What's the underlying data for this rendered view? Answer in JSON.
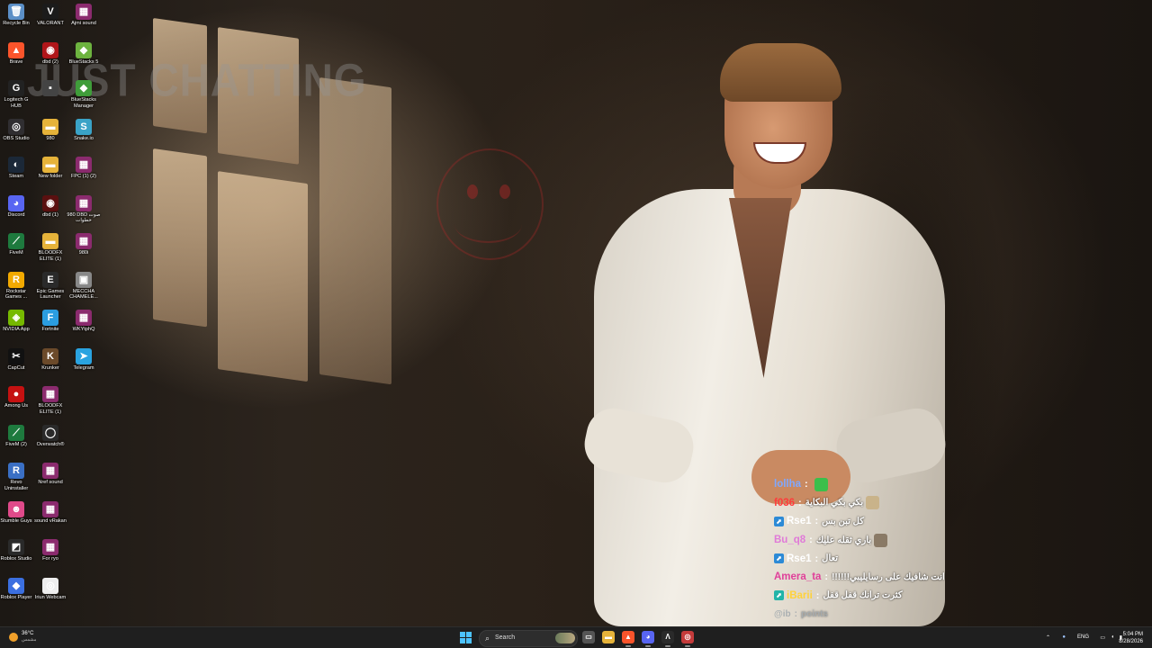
{
  "wallpaper": {
    "overlay_text": "JUST CHATTING"
  },
  "desktop_icons": [
    {
      "label": "Recycle Bin",
      "icon": "recycle-bin-icon",
      "color": "#5b8fc7",
      "glyph": "🗑"
    },
    {
      "label": "VALORANT",
      "icon": "valorant-icon",
      "color": "#1b1b1b",
      "glyph": "V"
    },
    {
      "label": "Ajmi sound",
      "icon": "winrar-icon",
      "color": "#8b2b6e",
      "glyph": "▦"
    },
    {
      "label": "Brave",
      "icon": "brave-icon",
      "color": "#fb542b",
      "glyph": "▲"
    },
    {
      "label": "dbd (2)",
      "icon": "dbd-icon",
      "color": "#b0161a",
      "glyph": "◉"
    },
    {
      "label": "BlueStacks 5",
      "icon": "bluestacks-icon",
      "color": "#6db33f",
      "glyph": "◆"
    },
    {
      "label": "Logitech G HUB",
      "icon": "logitech-icon",
      "color": "#222",
      "glyph": "G"
    },
    {
      "label": "",
      "icon": "app-icon",
      "color": "#444",
      "glyph": "▪"
    },
    {
      "label": "BlueStacks Manager",
      "icon": "bluestacks-manager-icon",
      "color": "#3f9d3a",
      "glyph": "◆"
    },
    {
      "label": "OBS Studio",
      "icon": "obs-icon",
      "color": "#302e31",
      "glyph": "◎"
    },
    {
      "label": "980",
      "icon": "folder-icon",
      "color": "#e6b33a",
      "glyph": "▬"
    },
    {
      "label": "Snake.io",
      "icon": "snake-icon",
      "color": "#3aa3c7",
      "glyph": "S"
    },
    {
      "label": "Steam",
      "icon": "steam-icon",
      "color": "#1b2838",
      "glyph": "◐"
    },
    {
      "label": "New folder",
      "icon": "folder-icon",
      "color": "#e6b33a",
      "glyph": "▬"
    },
    {
      "label": "FPC (1) (2)",
      "icon": "winrar-icon",
      "color": "#8b2b6e",
      "glyph": "▦"
    },
    {
      "label": "Discord",
      "icon": "discord-icon",
      "color": "#5865f2",
      "glyph": "◕"
    },
    {
      "label": "dbd (1)",
      "icon": "dbd-icon",
      "color": "#5a1010",
      "glyph": "◉"
    },
    {
      "label": "980 DBD صوت خطوات",
      "icon": "winrar-icon",
      "color": "#8b2b6e",
      "glyph": "▦"
    },
    {
      "label": "FiveM",
      "icon": "fivem-icon",
      "color": "#1e7a3e",
      "glyph": "⟋"
    },
    {
      "label": "BLOODFX ELITE (1)",
      "icon": "folder-icon",
      "color": "#e6b33a",
      "glyph": "▬"
    },
    {
      "label": "980i",
      "icon": "winrar-icon",
      "color": "#8b2b6e",
      "glyph": "▦"
    },
    {
      "label": "Rockstar Games ...",
      "icon": "rockstar-icon",
      "color": "#f2a900",
      "glyph": "R"
    },
    {
      "label": "Epic Games Launcher",
      "icon": "epic-icon",
      "color": "#2a2a2a",
      "glyph": "E"
    },
    {
      "label": "MECCHA CHAMELE...",
      "icon": "file-icon",
      "color": "#888",
      "glyph": "▣"
    },
    {
      "label": "NVIDIA App",
      "icon": "nvidia-icon",
      "color": "#76b900",
      "glyph": "◈"
    },
    {
      "label": "Fortnite",
      "icon": "fortnite-icon",
      "color": "#2b9de0",
      "glyph": "F"
    },
    {
      "label": "WKYtphQ",
      "icon": "winrar-icon",
      "color": "#8b2b6e",
      "glyph": "▦"
    },
    {
      "label": "CapCut",
      "icon": "capcut-icon",
      "color": "#111",
      "glyph": "✂"
    },
    {
      "label": "Krunker",
      "icon": "krunker-icon",
      "color": "#6b4a2a",
      "glyph": "K"
    },
    {
      "label": "Telegram",
      "icon": "telegram-icon",
      "color": "#2aa3e0",
      "glyph": "➤"
    },
    {
      "label": "Among Us",
      "icon": "among-us-icon",
      "color": "#c51111",
      "glyph": "●"
    },
    {
      "label": "BLOODFX ELITE (1)",
      "icon": "winrar-icon",
      "color": "#8b2b6e",
      "glyph": "▦"
    },
    {
      "label": "",
      "icon": "blank-icon",
      "color": "transparent",
      "glyph": ""
    },
    {
      "label": "FiveM (2)",
      "icon": "fivem-icon",
      "color": "#1e7a3e",
      "glyph": "⟋"
    },
    {
      "label": "Overwatch®",
      "icon": "overwatch-icon",
      "color": "#2a2a2a",
      "glyph": "◯"
    },
    {
      "label": "",
      "icon": "blank-icon",
      "color": "transparent",
      "glyph": ""
    },
    {
      "label": "Revo Uninstaller",
      "icon": "revo-icon",
      "color": "#3a6fc4",
      "glyph": "R"
    },
    {
      "label": "Nref sound",
      "icon": "winrar-icon",
      "color": "#8b2b6e",
      "glyph": "▦"
    },
    {
      "label": "",
      "icon": "blank-icon",
      "color": "transparent",
      "glyph": ""
    },
    {
      "label": "Stumble Guys",
      "icon": "stumble-guys-icon",
      "color": "#e04a8a",
      "glyph": "☻"
    },
    {
      "label": "sound vRakan",
      "icon": "winrar-icon",
      "color": "#8b2b6e",
      "glyph": "▦"
    },
    {
      "label": "",
      "icon": "blank-icon",
      "color": "transparent",
      "glyph": ""
    },
    {
      "label": "Roblox Studio",
      "icon": "roblox-studio-icon",
      "color": "#2a2a2a",
      "glyph": "◩"
    },
    {
      "label": "For ryo",
      "icon": "winrar-icon",
      "color": "#8b2b6e",
      "glyph": "▦"
    },
    {
      "label": "",
      "icon": "blank-icon",
      "color": "transparent",
      "glyph": ""
    },
    {
      "label": "Roblox Player",
      "icon": "roblox-icon",
      "color": "#3b6fe0",
      "glyph": "◆"
    },
    {
      "label": "Iriun Webcam",
      "icon": "iriun-webcam-icon",
      "color": "#eee",
      "glyph": "◎"
    }
  ],
  "chat": [
    {
      "user": "lollha",
      "user_color": "#7fa8ff",
      "badge": "",
      "msg": "",
      "emote": "#3bbf4b"
    },
    {
      "user": "f036",
      "user_color": "#ff3b3b",
      "badge": "",
      "msg": "بكي بكي البكاية",
      "emote": "#c9b38a"
    },
    {
      "user": "Rse1",
      "user_color": "#ffffff",
      "badge": "prime",
      "msg": "كل تبن بس",
      "emote": ""
    },
    {
      "user": "Bu_q8",
      "user_color": "#e07ad8",
      "badge": "",
      "msg": "باري ثقله عليك",
      "emote": "#8a7a66"
    },
    {
      "user": "Rse1",
      "user_color": "#ffffff",
      "badge": "prime",
      "msg": "تعال",
      "emote": ""
    },
    {
      "user": "Amera_ta",
      "user_color": "#e0409a",
      "badge": "",
      "msg": "!!!!!!انت شافيك على رسايليبي",
      "emote": ""
    },
    {
      "user": "iBarii",
      "user_color": "#ffd23a",
      "badge": "prime2",
      "msg": "كثرت ترانك قفل قفل",
      "emote": ""
    },
    {
      "user": "@ib",
      "user_color": "#7a8a99",
      "badge": "",
      "msg": "points",
      "emote": "",
      "faded": true
    }
  ],
  "taskbar": {
    "weather_temp": "36°C",
    "weather_desc": "مشمس",
    "search_placeholder": "Search",
    "apps": [
      {
        "name": "task-view-icon",
        "color": "#555",
        "glyph": "▭"
      },
      {
        "name": "file-explorer-icon",
        "color": "#e6b33a",
        "glyph": "▬"
      },
      {
        "name": "brave-icon",
        "color": "#fb542b",
        "glyph": "▲"
      },
      {
        "name": "discord-icon",
        "color": "#5865f2",
        "glyph": "◕"
      },
      {
        "name": "terminal-icon",
        "color": "#2a2a2a",
        "glyph": "Λ"
      },
      {
        "name": "obs-icon",
        "color": "#c43b3b",
        "glyph": "◎"
      }
    ],
    "language": "ENG",
    "time": "5:04 PM",
    "date": "8/28/2026"
  }
}
